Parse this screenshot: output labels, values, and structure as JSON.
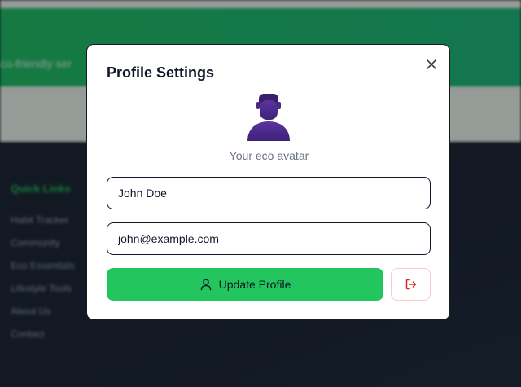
{
  "background": {
    "banner_text": "co-friendly ser",
    "footer_heading": "Quick Links",
    "footer_links": [
      "Habit Tracker",
      "Community",
      "Eco Essentials",
      "Lifestyle Tools",
      "About Us",
      "Contact"
    ]
  },
  "modal": {
    "title": "Profile Settings",
    "avatar_caption": "Your eco avatar",
    "name_value": "John Doe",
    "email_value": "john@example.com",
    "update_label": "Update Profile",
    "icons": {
      "close": "close-icon",
      "avatar": "user-avatar",
      "user": "user-icon",
      "logout": "logout-icon"
    }
  },
  "colors": {
    "accent": "#22c55e",
    "avatar": "#4c2a85",
    "logout": "#dc2626"
  }
}
